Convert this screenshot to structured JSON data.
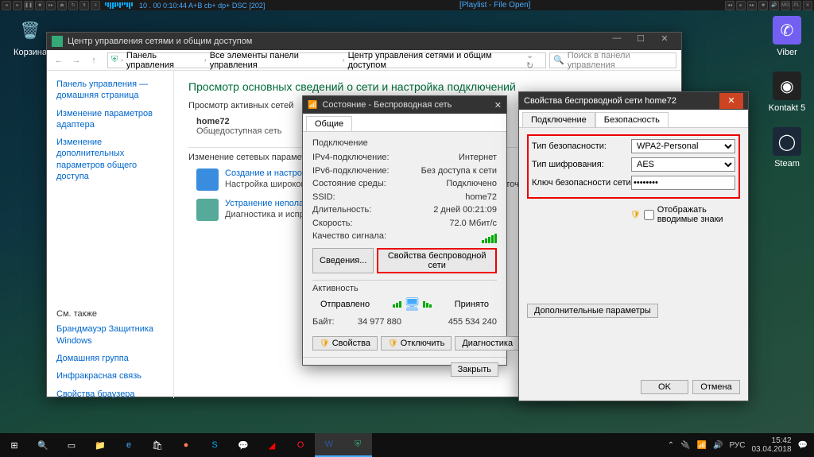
{
  "media_player": {
    "title": "[Playlist - File Open]",
    "time_text": "10 . 00 0:10:44 A+B cb+ dp+ DSC [202]"
  },
  "desktop": {
    "recycle": "Корзина",
    "viber": "Viber",
    "kontakt": "Kontakt 5",
    "steam": "Steam"
  },
  "network_center": {
    "title": "Центр управления сетями и общим доступом",
    "breadcrumb": [
      "Панель управления",
      "Все элементы панели управления",
      "Центр управления сетями и общим доступом"
    ],
    "search_placeholder": "Поиск в панели управления",
    "sidebar": {
      "links": [
        "Панель управления — домашняя страница",
        "Изменение параметров адаптера",
        "Изменение дополнительных параметров общего доступа"
      ],
      "see_also_title": "См. также",
      "see_also": [
        "Брандмауэр Защитника Windows",
        "Домашняя группа",
        "Инфракрасная связь",
        "Свойства браузера"
      ]
    },
    "main": {
      "head": "Просмотр основных сведений о сети и настройка подключений",
      "active_net_label": "Просмотр активных сетей",
      "network_name": "home72",
      "network_type": "Общедоступная сеть",
      "change_params_label": "Изменение сетевых параметров",
      "setup_link": "Создание и настройка нового подключения или сети",
      "setup_desc": "Настройка широкополосного подключения или маршрутизатора или точки доступа.",
      "troubleshoot_link": "Устранение неполадок",
      "troubleshoot_desc": "Диагностика и исправление неполадок."
    }
  },
  "status": {
    "title": "Состояние - Беспроводная сеть",
    "tab": "Общие",
    "connection_label": "Подключение",
    "rows": {
      "ipv4_label": "IPv4-подключение:",
      "ipv4_value": "Интернет",
      "ipv6_label": "IPv6-подключение:",
      "ipv6_value": "Без доступа к сети",
      "media_label": "Состояние среды:",
      "media_value": "Подключено",
      "ssid_label": "SSID:",
      "ssid_value": "home72",
      "duration_label": "Длительность:",
      "duration_value": "2 дней 00:21:09",
      "speed_label": "Скорость:",
      "speed_value": "72.0 Мбит/с",
      "signal_label": "Качество сигнала:"
    },
    "details_btn": "Сведения...",
    "wifi_props_btn": "Свойства беспроводной сети",
    "activity_label": "Активность",
    "sent_label": "Отправлено",
    "recv_label": "Принято",
    "bytes_label": "Байт:",
    "sent_value": "34 977 880",
    "recv_value": "455 534 240",
    "props_btn": "Свойства",
    "disable_btn": "Отключить",
    "diag_btn": "Диагностика",
    "close_btn": "Закрыть"
  },
  "props_window": {
    "title": "Свойства беспроводной сети home72",
    "tabs": [
      "Подключение",
      "Безопасность"
    ],
    "sec_type_label": "Тип безопасности:",
    "sec_type_value": "WPA2-Personal",
    "enc_label": "Тип шифрования:",
    "enc_value": "AES",
    "key_label": "Ключ безопасности сети",
    "key_value": "••••••••",
    "show_chars": "Отображать вводимые знаки",
    "extra_btn": "Дополнительные параметры",
    "ok_btn": "OK",
    "cancel_btn": "Отмена"
  },
  "taskbar": {
    "lang": "РУС",
    "time": "15:42",
    "date": "03.04.2018"
  }
}
